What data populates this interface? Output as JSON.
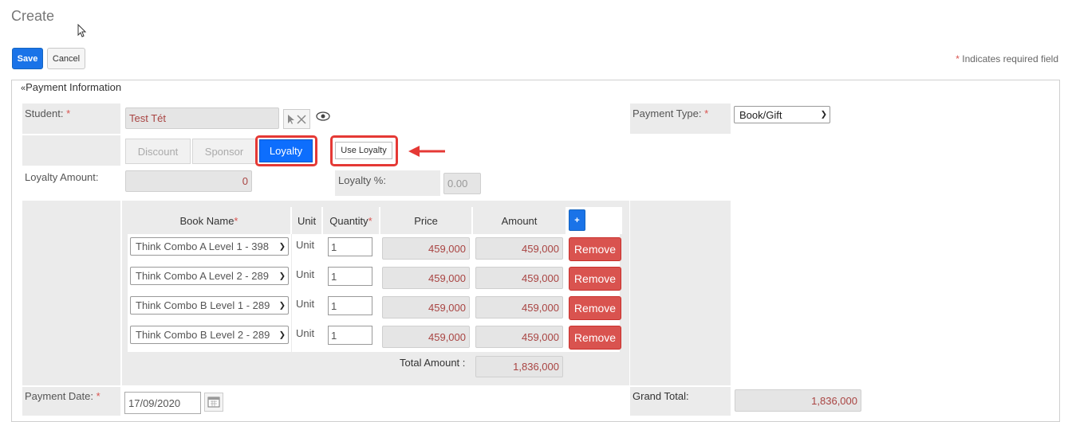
{
  "page": {
    "title": "Create"
  },
  "toolbar": {
    "save_label": "Save",
    "cancel_label": "Cancel"
  },
  "required_note": {
    "star": "*",
    "text": " Indicates required field"
  },
  "panel": {
    "header_icon": "double-chevron-up-icon",
    "header_label": "Payment Information"
  },
  "student": {
    "label": "Student:",
    "star": "*",
    "value": "Test Tét"
  },
  "payment_type": {
    "label": "Payment Type:",
    "star": "*",
    "selected": "Book/Gift"
  },
  "tabs": [
    "Discount",
    "Sponsor",
    "Loyalty"
  ],
  "active_tab": "Loyalty",
  "use_loyalty_label": "Use Loyalty",
  "loyalty": {
    "amount_label": "Loyalty Amount:",
    "amount_value": "0",
    "percent_label": "Loyalty %:",
    "percent_value": "0.00"
  },
  "books_table": {
    "headers": {
      "book_name": "Book Name",
      "unit": "Unit",
      "quantity": "Quantity",
      "price": "Price",
      "amount": "Amount",
      "add": "+"
    },
    "star": "*",
    "rows": [
      {
        "book": "Think Combo A Level 1 - 398",
        "unit": "Unit",
        "quantity": "1",
        "price": "459,000",
        "amount": "459,000",
        "remove": "Remove"
      },
      {
        "book": "Think Combo A Level 2 - 289",
        "unit": "Unit",
        "quantity": "1",
        "price": "459,000",
        "amount": "459,000",
        "remove": "Remove"
      },
      {
        "book": "Think Combo B Level 1 - 289",
        "unit": "Unit",
        "quantity": "1",
        "price": "459,000",
        "amount": "459,000",
        "remove": "Remove"
      },
      {
        "book": "Think Combo B Level 2 - 289",
        "unit": "Unit",
        "quantity": "1",
        "price": "459,000",
        "amount": "459,000",
        "remove": "Remove"
      }
    ],
    "total_label": "Total Amount :",
    "total_value": "1,836,000"
  },
  "payment_date": {
    "label": "Payment Date:",
    "star": "*",
    "value": "17/09/2020"
  },
  "grand_total": {
    "label": "Grand Total:",
    "value": "1,836,000"
  },
  "colors": {
    "primary": "#1a73e8",
    "danger": "#d9534f",
    "highlight": "#e53935",
    "active_tab": "#0d6efd"
  }
}
